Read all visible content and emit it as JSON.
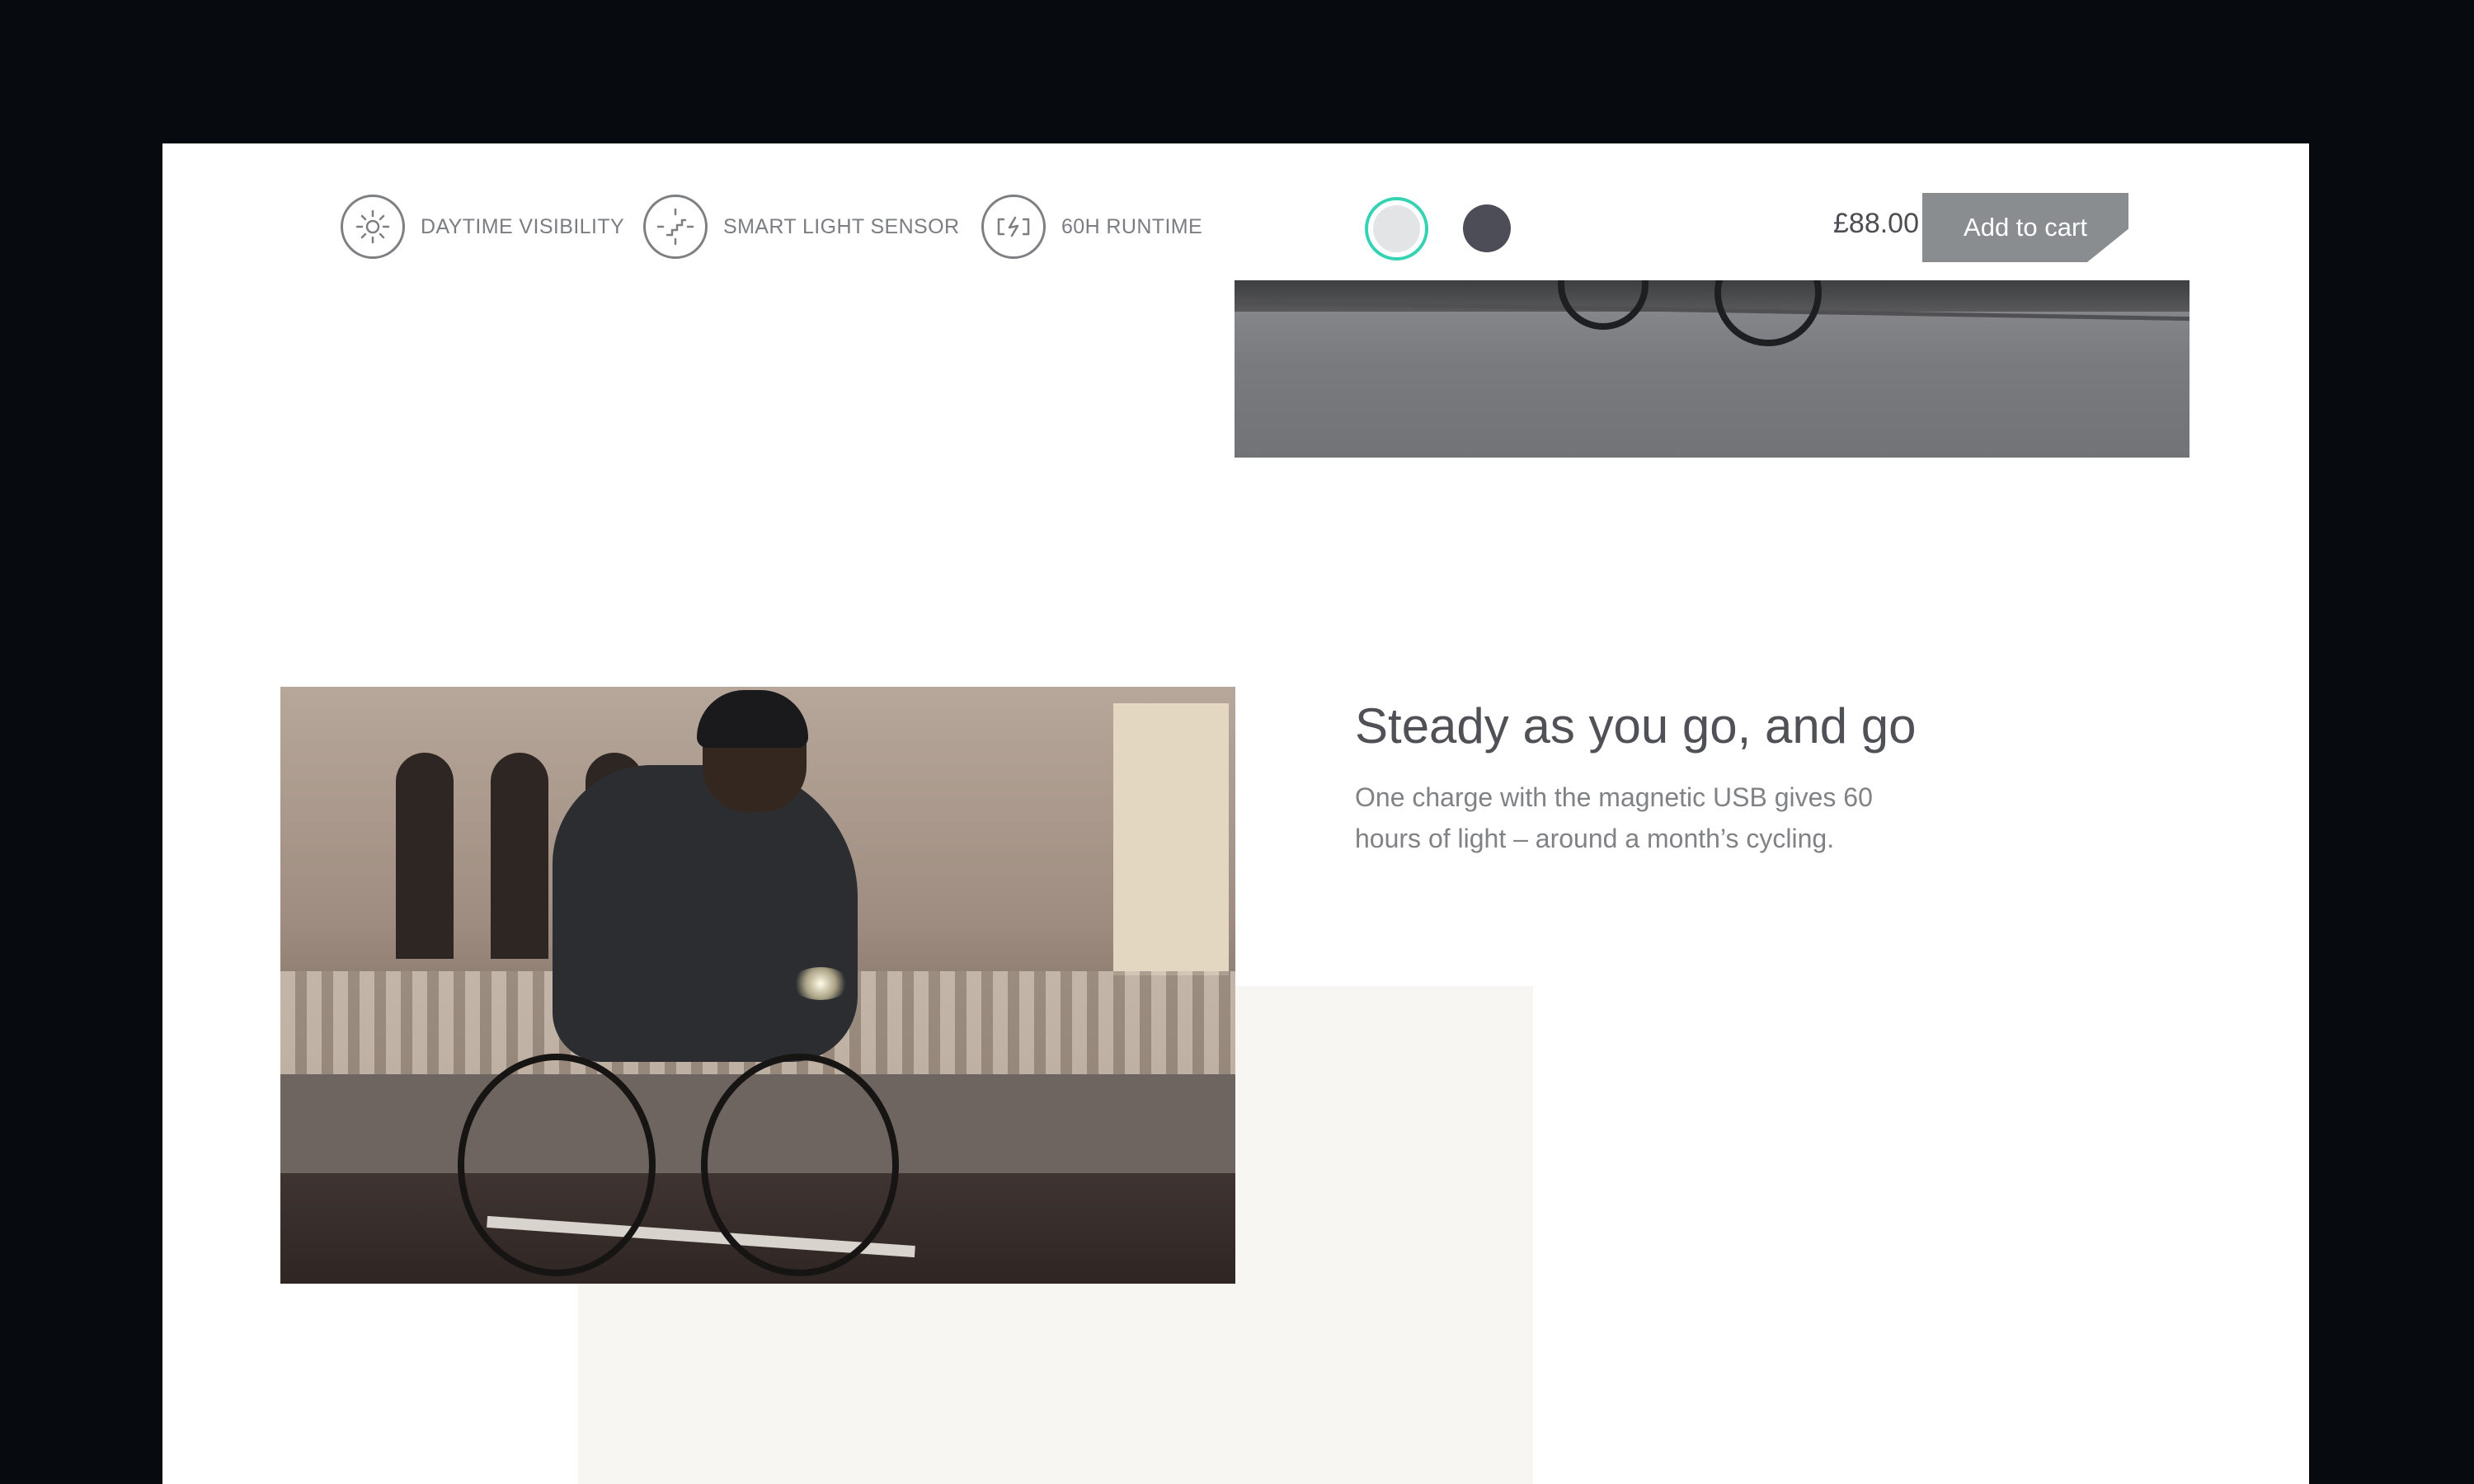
{
  "features": [
    {
      "icon": "sun-icon",
      "label": "DAYTIME VISIBILITY"
    },
    {
      "icon": "light-sensor-icon",
      "label": "SMART LIGHT SENSOR"
    },
    {
      "icon": "battery-charge-icon",
      "label": "60H RUNTIME"
    }
  ],
  "swatches": [
    {
      "name": "light",
      "color": "#e2e4e6",
      "selected": true
    },
    {
      "name": "dark",
      "color": "#4c4d56",
      "selected": false
    }
  ],
  "product": {
    "price": "£88.00",
    "add_to_cart_label": "Add to cart"
  },
  "section": {
    "headline": "Steady as you go, and go",
    "body": "One charge with the magnetic USB gives 60 hours of light – around a month’s cycling."
  },
  "colors": {
    "accent_selected": "#35d2b4",
    "button_bg": "#8a8d90",
    "headline": "#505157",
    "body_text": "#808286",
    "cream_block": "#f8f6f3"
  }
}
